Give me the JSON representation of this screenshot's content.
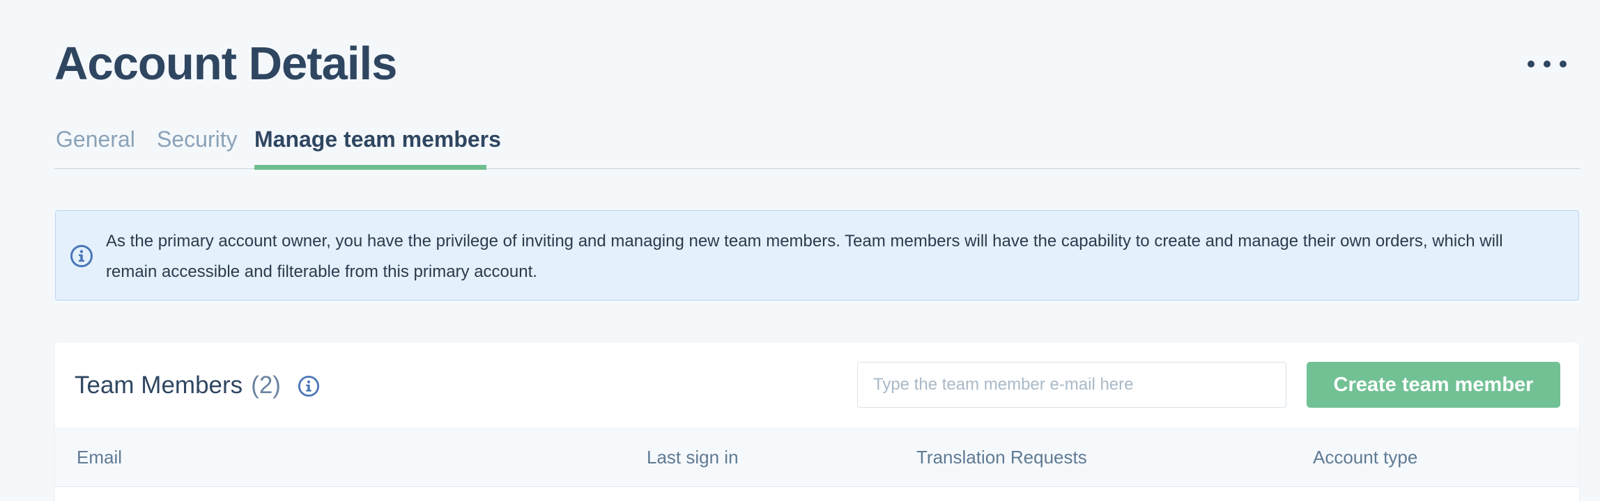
{
  "page": {
    "title": "Account Details",
    "more_icon": "more-horizontal-icon"
  },
  "tabs": [
    {
      "label": "General",
      "active": false
    },
    {
      "label": "Security",
      "active": false
    },
    {
      "label": "Manage team members",
      "active": true
    }
  ],
  "info_banner": {
    "icon": "info-icon",
    "text": "As the primary account owner, you have the privilege of inviting and managing new team members. Team members will have the capability to create and manage their own orders, which will remain accessible and filterable from this primary account."
  },
  "team_members": {
    "title": "Team Members",
    "count": "(2)",
    "info_icon": "info-icon",
    "search": {
      "value": "",
      "placeholder": "Type the team member e-mail here"
    },
    "create_button_label": "Create team member",
    "columns": [
      "Email",
      "Last sign in",
      "Translation Requests",
      "Account type"
    ]
  },
  "colors": {
    "accent_green": "#72c195",
    "title_text": "#2f4661",
    "banner_background": "#e4f0fb",
    "banner_border": "#b9d6f2",
    "info_icon_blue": "#4a76b8"
  }
}
